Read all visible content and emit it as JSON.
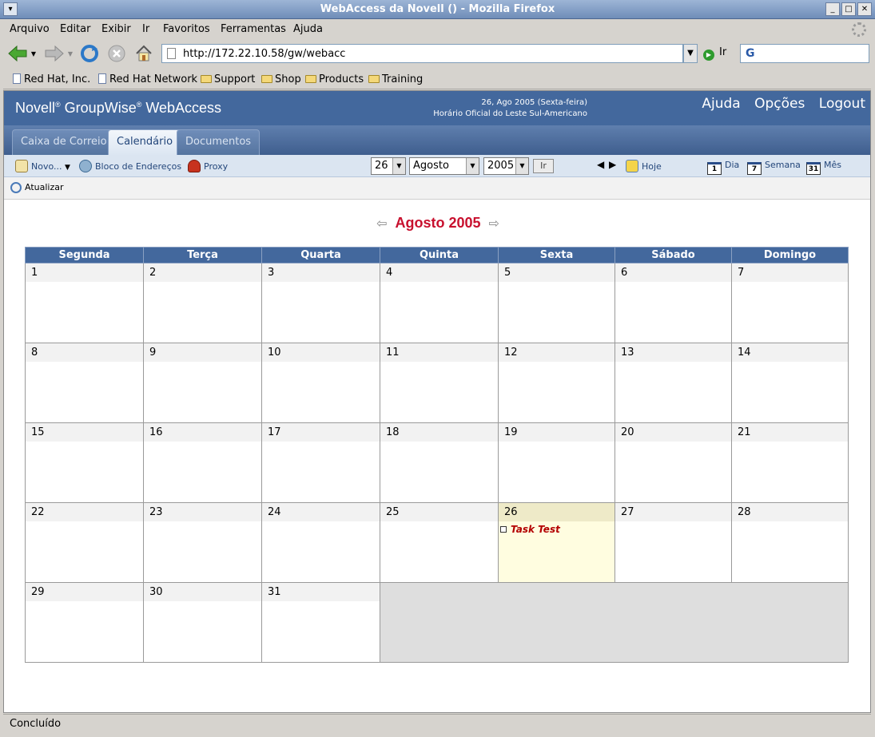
{
  "window": {
    "title": "WebAccess da Novell () - Mozilla Firefox"
  },
  "menu": [
    "Arquivo",
    "Editar",
    "Exibir",
    "Ir",
    "Favoritos",
    "Ferramentas",
    "Ajuda"
  ],
  "nav": {
    "url": "http://172.22.10.58/gw/webacc",
    "go_label": "Ir"
  },
  "bookmarks": [
    "Red Hat, Inc.",
    "Red Hat Network",
    "Support",
    "Shop",
    "Products",
    "Training"
  ],
  "gw": {
    "logo": "Novell® GroupWise® WebAccess",
    "logo_a": "Novell",
    "logo_b": " GroupWise",
    "logo_c": " WebAccess",
    "date_line1": "26, Ago 2005 (Sexta-feira)",
    "date_line2": "Horário Oficial do Leste Sul-Americano",
    "links": [
      "Ajuda",
      "Opções",
      "Logout"
    ],
    "tabs": [
      "Caixa de Correio",
      "Calendário",
      "Documentos"
    ],
    "active_tab": "Calendário"
  },
  "toolbar": {
    "new_label": "Novo...",
    "address_book_label": "Bloco de Endereços",
    "proxy_label": "Proxy",
    "day_value": "26",
    "month_value": "Agosto",
    "year_value": "2005",
    "go_label": "Ir",
    "today_label": "Hoje",
    "day_view_label": "Dia",
    "day_view_icon": "1",
    "week_view_label": "Semana",
    "week_view_icon": "7",
    "month_view_label": "Mês",
    "month_view_icon": "31",
    "refresh_label": "Atualizar"
  },
  "calendar": {
    "title": "Agosto 2005",
    "weekdays": [
      "Segunda",
      "Terça",
      "Quarta",
      "Quinta",
      "Sexta",
      "Sábado",
      "Domingo"
    ],
    "weeks": [
      [
        "1",
        "2",
        "3",
        "4",
        "5",
        "6",
        "7"
      ],
      [
        "8",
        "9",
        "10",
        "11",
        "12",
        "13",
        "14"
      ],
      [
        "15",
        "16",
        "17",
        "18",
        "19",
        "20",
        "21"
      ],
      [
        "22",
        "23",
        "24",
        "25",
        "26",
        "27",
        "28"
      ],
      [
        "29",
        "30",
        "31",
        "",
        "",
        "",
        ""
      ]
    ],
    "today": "26",
    "task": {
      "day": "26",
      "label": "Task Test"
    }
  },
  "status": {
    "text": "Concluído"
  }
}
